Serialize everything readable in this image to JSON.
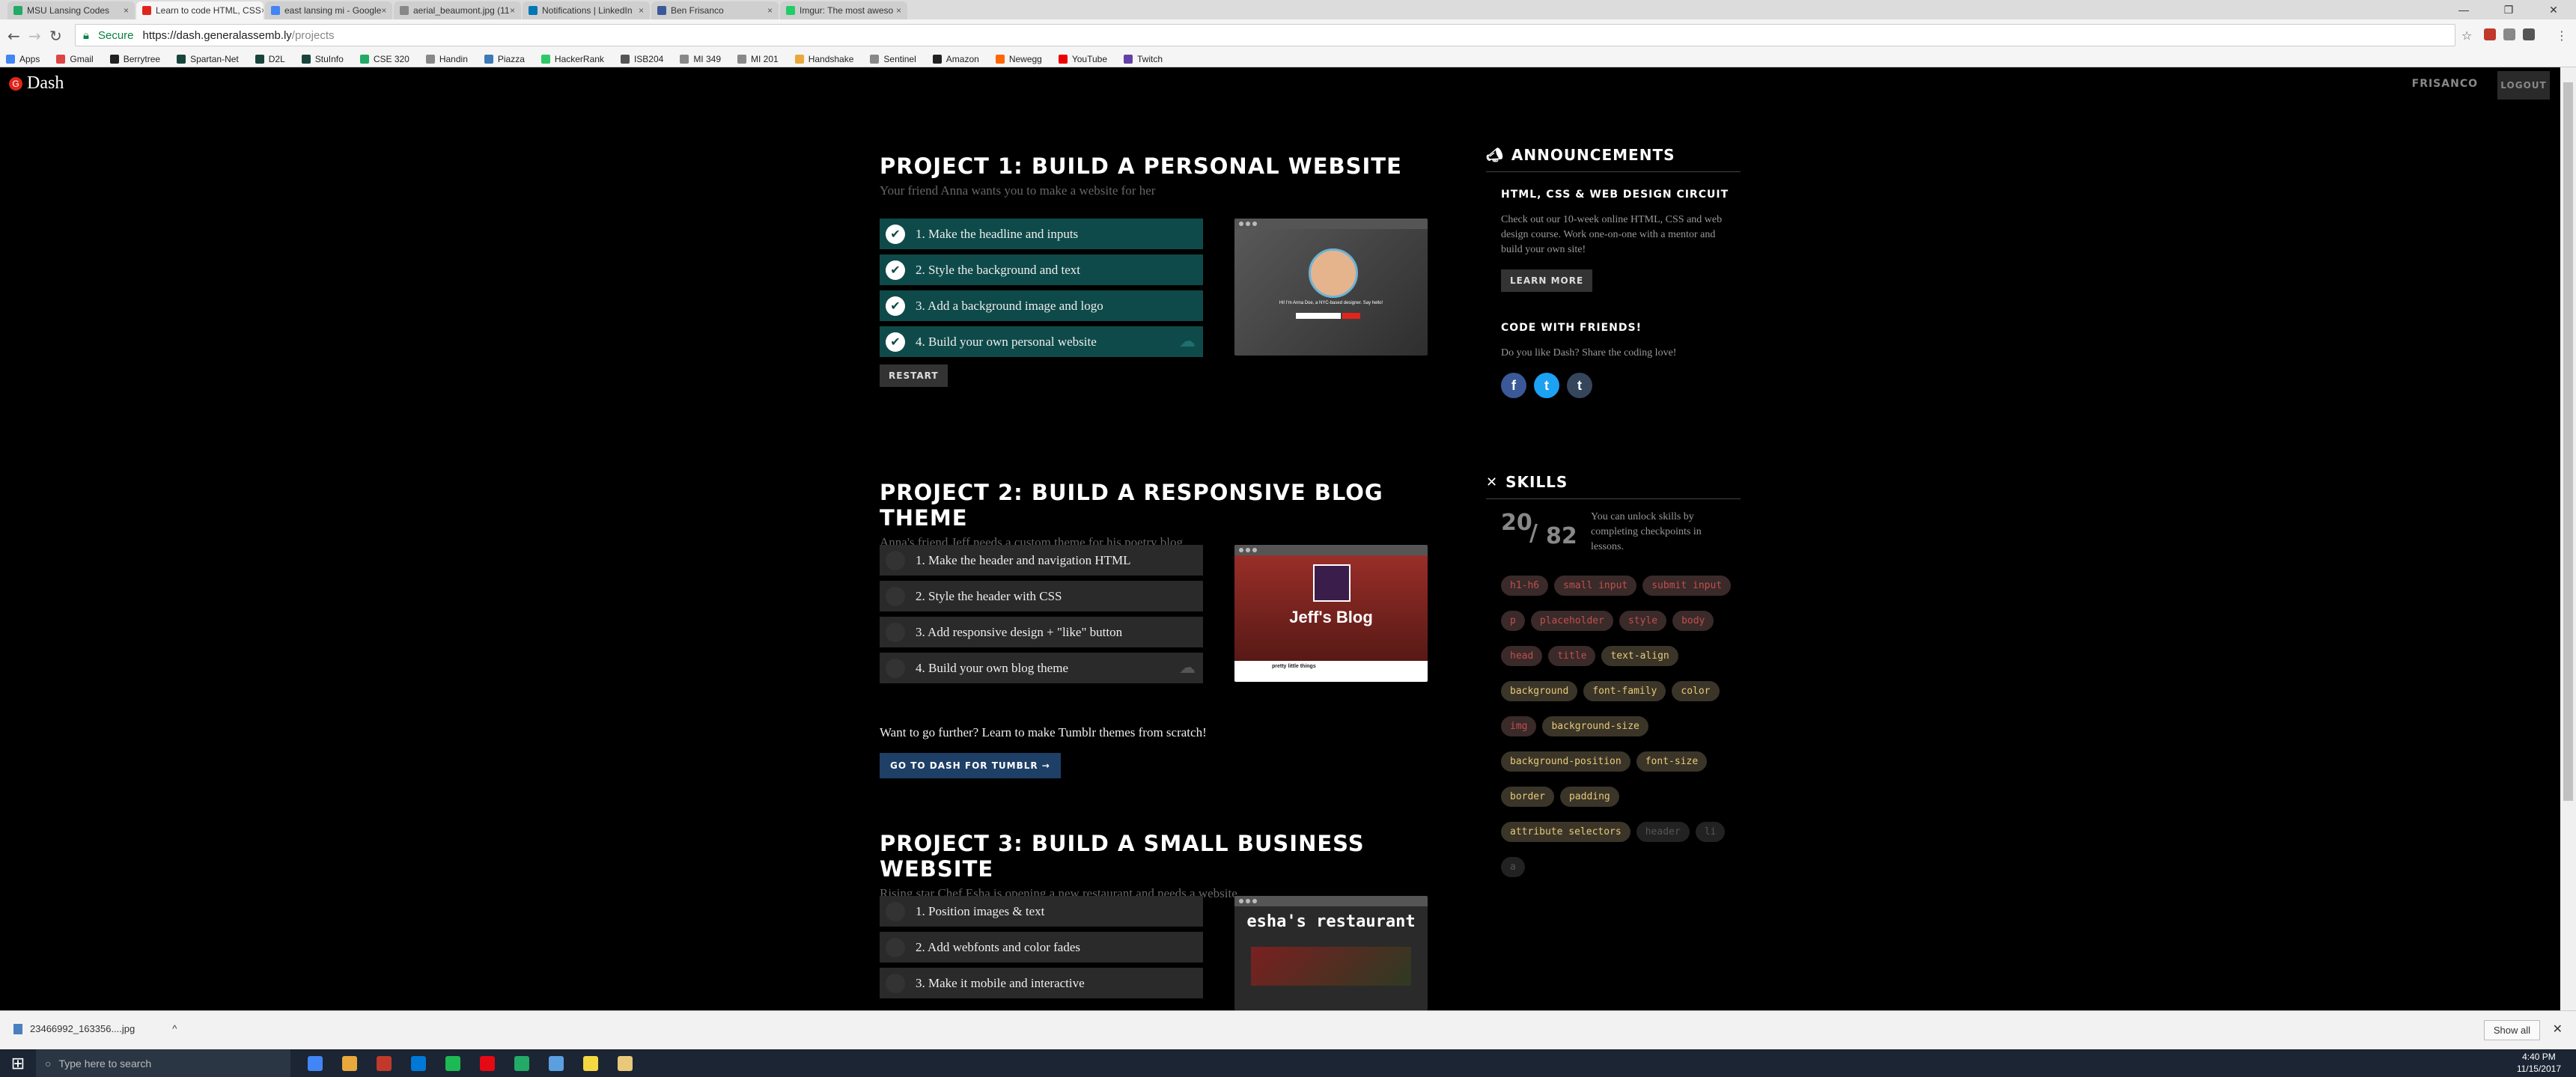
{
  "browser": {
    "tabs": [
      {
        "label": "MSU Lansing Codes",
        "color": "#2a6"
      },
      {
        "label": "Learn to code HTML, CSS",
        "color": "#e1251b",
        "active": true
      },
      {
        "label": "east lansing mi - Google",
        "color": "#4285f4"
      },
      {
        "label": "aerial_beaumont.jpg (11",
        "color": "#888"
      },
      {
        "label": "Notifications | LinkedIn",
        "color": "#0077b5"
      },
      {
        "label": "Ben Frisanco",
        "color": "#3b5998"
      },
      {
        "label": "Imgur: The most aweso",
        "color": "#2c6"
      }
    ],
    "window_controls": [
      "—",
      "❐",
      "✕"
    ],
    "secure_label": "Secure",
    "url_host": "https://dash.generalassemb.ly",
    "url_path": "/projects"
  },
  "bookmarks": [
    {
      "label": "Apps",
      "color": "#4285f4"
    },
    {
      "label": "Gmail",
      "color": "#d44"
    },
    {
      "label": "Berrytree",
      "color": "#222"
    },
    {
      "label": "Spartan-Net",
      "color": "#18453b"
    },
    {
      "label": "D2L",
      "color": "#18453b"
    },
    {
      "label": "StuInfo",
      "color": "#18453b"
    },
    {
      "label": "CSE 320",
      "color": "#2a6"
    },
    {
      "label": "Handin",
      "color": "#888"
    },
    {
      "label": "Piazza",
      "color": "#3d7ab8"
    },
    {
      "label": "HackerRank",
      "color": "#2ec866"
    },
    {
      "label": "ISB204",
      "color": "#555"
    },
    {
      "label": "MI 349",
      "color": "#888"
    },
    {
      "label": "MI 201",
      "color": "#888"
    },
    {
      "label": "Handshake",
      "color": "#e8a83c"
    },
    {
      "label": "Sentinel",
      "color": "#888"
    },
    {
      "label": "Amazon",
      "color": "#222"
    },
    {
      "label": "Newegg",
      "color": "#f60"
    },
    {
      "label": "YouTube",
      "color": "#e00"
    },
    {
      "label": "Twitch",
      "color": "#6441a4"
    }
  ],
  "site": {
    "logo": "Dash",
    "logo_mark": "G",
    "username": "FRISANCO",
    "logout": "LOGOUT"
  },
  "projects": [
    {
      "title": "PROJECT 1: BUILD A PERSONAL WEBSITE",
      "subtitle": "Your friend Anna wants you to make a website for her",
      "steps": [
        {
          "label": "1. Make the headline and inputs",
          "done": true
        },
        {
          "label": "2. Style the background and text",
          "done": true
        },
        {
          "label": "3. Add a background image and logo",
          "done": true
        },
        {
          "label": "4. Build your own personal website",
          "done": true,
          "cloud": true
        }
      ],
      "restart": "RESTART",
      "thumb_caption": "Hi! I'm Anna Doe, a NYC-based designer. Say hello!"
    },
    {
      "title": "PROJECT 2: BUILD A RESPONSIVE BLOG THEME",
      "subtitle": "Anna's friend Jeff needs a custom theme for his poetry blog",
      "steps": [
        {
          "label": "1. Make the header and navigation HTML",
          "done": false
        },
        {
          "label": "2. Style the header with CSS",
          "done": false
        },
        {
          "label": "3. Add responsive design + \"like\" button",
          "done": false
        },
        {
          "label": "4. Build your own blog theme",
          "done": false,
          "cloud": true
        }
      ],
      "thumb_caption": "Jeff's Blog",
      "thumb_sub": "pretty little things",
      "further_text": "Want to go further? Learn to make Tumblr themes from scratch!",
      "further_button": "GO TO DASH FOR TUMBLR →"
    },
    {
      "title": "PROJECT 3: BUILD A SMALL BUSINESS WEBSITE",
      "subtitle": "Rising star Chef Esha is opening a new restaurant and needs a website",
      "steps": [
        {
          "label": "1. Position images & text",
          "done": false
        },
        {
          "label": "2. Add webfonts and color fades",
          "done": false
        },
        {
          "label": "3. Make it mobile and interactive",
          "done": false
        }
      ],
      "thumb_caption": "esha's restaurant"
    }
  ],
  "sidebar": {
    "announcements": {
      "heading": "ANNOUNCEMENTS",
      "title": "HTML, CSS & WEB DESIGN CIRCUIT",
      "body": "Check out our 10-week online HTML, CSS and web design course. Work one-on-one with a mentor and build your own site!",
      "button": "LEARN MORE"
    },
    "friends": {
      "title": "CODE WITH FRIENDS!",
      "body": "Do you like Dash? Share the coding love!",
      "icons": [
        "f",
        "t",
        "t"
      ],
      "icon_colors": [
        "#3b5998",
        "#1da1f2",
        "#35465c"
      ]
    },
    "skills": {
      "heading": "SKILLS",
      "unlocked": "20",
      "total": "82",
      "body": "You can unlock skills by completing checkpoints in lessons.",
      "tags": [
        {
          "label": "h1-h6",
          "color": "#c0504d",
          "bg": "#3a2a2a"
        },
        {
          "label": "small input",
          "color": "#c0504d",
          "bg": "#3a2a2a"
        },
        {
          "label": "submit input",
          "color": "#c0504d",
          "bg": "#3a2a2a"
        },
        {
          "label": "p",
          "color": "#c0504d",
          "bg": "#3a2a2a"
        },
        {
          "label": "placeholder",
          "color": "#c0504d",
          "bg": "#3a2a2a"
        },
        {
          "label": "style",
          "color": "#c0504d",
          "bg": "#3a2a2a"
        },
        {
          "label": "body",
          "color": "#c0504d",
          "bg": "#3a2a2a"
        },
        {
          "label": "head",
          "color": "#c0504d",
          "bg": "#3a2a2a"
        },
        {
          "label": "title",
          "color": "#c0504d",
          "bg": "#3a2a2a"
        },
        {
          "label": "text-align",
          "color": "#e8c97a",
          "bg": "#3a3528"
        },
        {
          "label": "background",
          "color": "#e8c97a",
          "bg": "#3a3528"
        },
        {
          "label": "font-family",
          "color": "#e8c97a",
          "bg": "#3a3528"
        },
        {
          "label": "color",
          "color": "#e8c97a",
          "bg": "#3a3528"
        },
        {
          "label": "img",
          "color": "#c0504d",
          "bg": "#3a2a2a"
        },
        {
          "label": "background-size",
          "color": "#e8c97a",
          "bg": "#3a3528"
        },
        {
          "label": "background-position",
          "color": "#e8c97a",
          "bg": "#3a3528"
        },
        {
          "label": "font-size",
          "color": "#e8c97a",
          "bg": "#3a3528"
        },
        {
          "label": "border",
          "color": "#e8c97a",
          "bg": "#3a3528"
        },
        {
          "label": "padding",
          "color": "#e8c97a",
          "bg": "#3a3528"
        },
        {
          "label": "attribute selectors",
          "color": "#e8c97a",
          "bg": "#3a3528"
        },
        {
          "label": "header",
          "color": "#555",
          "bg": "#222"
        },
        {
          "label": "li",
          "color": "#555",
          "bg": "#222"
        },
        {
          "label": "a",
          "color": "#555",
          "bg": "#222"
        }
      ]
    }
  },
  "downloads": {
    "file": "23466992_163356....jpg",
    "show_all": "Show all"
  },
  "taskbar": {
    "search_placeholder": "Type here to search",
    "apps": [
      "#4285f4",
      "#e8a83c",
      "#c0392b",
      "#0078d7",
      "#1db954",
      "#e50914",
      "#2a6",
      "#5aa0e0",
      "#f5d742",
      "#e8c97a"
    ],
    "time": "4:40 PM",
    "date": "11/15/2017"
  }
}
